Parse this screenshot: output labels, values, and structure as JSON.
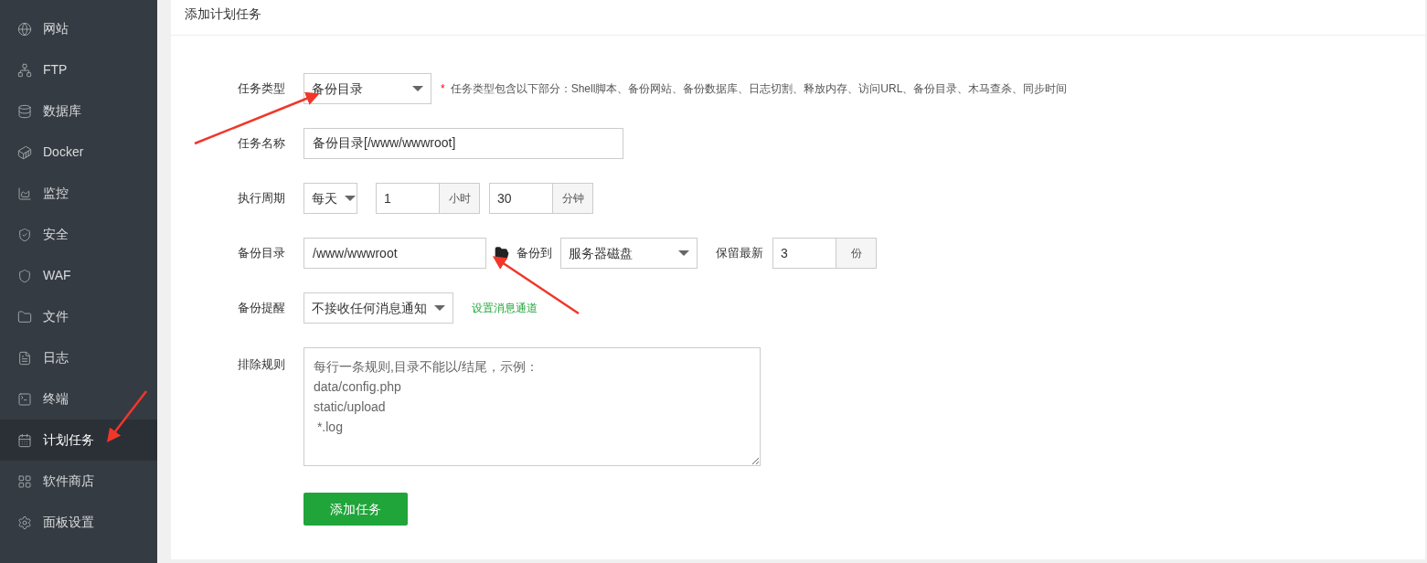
{
  "sidebar": {
    "items": [
      {
        "label": "网站",
        "selected": false
      },
      {
        "label": "FTP",
        "selected": false
      },
      {
        "label": "数据库",
        "selected": false
      },
      {
        "label": "Docker",
        "selected": false
      },
      {
        "label": "监控",
        "selected": false
      },
      {
        "label": "安全",
        "selected": false
      },
      {
        "label": "WAF",
        "selected": false
      },
      {
        "label": "文件",
        "selected": false
      },
      {
        "label": "日志",
        "selected": false
      },
      {
        "label": "终端",
        "selected": false
      },
      {
        "label": "计划任务",
        "selected": true
      },
      {
        "label": "软件商店",
        "selected": false
      },
      {
        "label": "面板设置",
        "selected": false
      }
    ]
  },
  "panel": {
    "title": "添加计划任务",
    "task_type": {
      "label": "任务类型",
      "value": "备份目录",
      "required_mark": "*",
      "hint": "任务类型包含以下部分：Shell脚本、备份网站、备份数据库、日志切割、释放内存、访问URL、备份目录、木马查杀、同步时间"
    },
    "task_name": {
      "label": "任务名称",
      "value": "备份目录[/www/wwwroot]"
    },
    "period": {
      "label": "执行周期",
      "cycle": "每天",
      "hour": "1",
      "hour_unit": "小时",
      "minute": "30",
      "minute_unit": "分钟"
    },
    "backup_dir": {
      "label": "备份目录",
      "value": "/www/wwwroot",
      "target_label": "备份到",
      "target": "服务器磁盘",
      "keep_label": "保留最新",
      "keep": "3",
      "keep_unit": "份"
    },
    "notify": {
      "label": "备份提醒",
      "value": "不接收任何消息通知",
      "link": "设置消息通道"
    },
    "exclude": {
      "label": "排除规则",
      "placeholder": "每行一条规则,目录不能以/结尾，示例：\ndata/config.php\nstatic/upload\n *.log"
    },
    "submit": "添加任务"
  }
}
